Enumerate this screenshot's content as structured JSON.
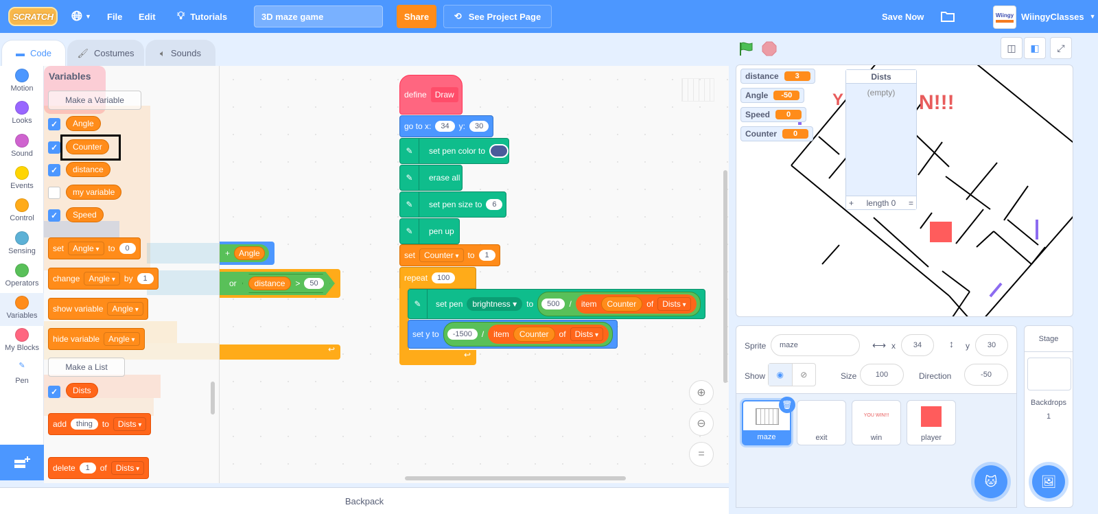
{
  "menubar": {
    "logo": "SCRATCH",
    "file": "File",
    "edit": "Edit",
    "tutorials": "Tutorials",
    "project_title": "3D maze game",
    "share": "Share",
    "see_project_page": "See Project Page",
    "save_now": "Save Now",
    "username": "WiingyClasses",
    "avatar_text": "Wiingy"
  },
  "tabs": [
    {
      "label": "Code",
      "active": true
    },
    {
      "label": "Costumes",
      "active": false
    },
    {
      "label": "Sounds",
      "active": false
    }
  ],
  "categories": [
    {
      "label": "Motion",
      "color": "#4c97ff"
    },
    {
      "label": "Looks",
      "color": "#9966ff"
    },
    {
      "label": "Sound",
      "color": "#cf63cf"
    },
    {
      "label": "Events",
      "color": "#ffd500"
    },
    {
      "label": "Control",
      "color": "#ffab19"
    },
    {
      "label": "Sensing",
      "color": "#5cb1d6"
    },
    {
      "label": "Operators",
      "color": "#59c059"
    },
    {
      "label": "Variables",
      "color": "#ff8c1a"
    },
    {
      "label": "My Blocks",
      "color": "#ff6680"
    },
    {
      "label": "Pen",
      "color": "#0fbd8c"
    }
  ],
  "palette": {
    "heading": "Variables",
    "make_variable": "Make a Variable",
    "variables": [
      {
        "name": "Angle",
        "checked": true
      },
      {
        "name": "Counter",
        "checked": true,
        "highlighted": true
      },
      {
        "name": "distance",
        "checked": true
      },
      {
        "name": "my variable",
        "checked": false
      },
      {
        "name": "Speed",
        "checked": true
      }
    ],
    "set_block": {
      "set": "set",
      "var": "Angle",
      "to": "to",
      "value": "0"
    },
    "change_block": {
      "change": "change",
      "var": "Angle",
      "by": "by",
      "value": "1"
    },
    "show_block": {
      "label": "show variable",
      "var": "Angle"
    },
    "hide_block": {
      "label": "hide variable",
      "var": "Angle"
    },
    "make_list": "Make a List",
    "list": {
      "name": "Dists",
      "checked": true
    },
    "add_block": {
      "add": "add",
      "value": "thing",
      "to": "to",
      "list": "Dists"
    },
    "delete_block": {
      "delete": "delete",
      "value": "1",
      "of": "of",
      "list": "Dists"
    }
  },
  "workspace": {
    "bg_blocks": {
      "plus": "+",
      "angle": "Angle",
      "or": "or",
      "distance": "distance",
      "gt": ">",
      "fifty": "50"
    },
    "script": {
      "define": "define",
      "define_name": "Draw",
      "goto": {
        "label": "go to x:",
        "x": "34",
        "ylabel": "y:",
        "y": "30"
      },
      "set_pen_color": {
        "label": "set pen color to",
        "color": "#4a5b9a"
      },
      "erase_all": "erase all",
      "set_pen_size": {
        "label": "set pen size to",
        "value": "6"
      },
      "pen_up": "pen up",
      "set_counter": {
        "set": "set",
        "var": "Counter",
        "to": "to",
        "value": "1"
      },
      "repeat": {
        "label": "repeat",
        "value": "100"
      },
      "set_pen_param": {
        "label": "set pen",
        "param": "brightness",
        "to": "to",
        "num": "500",
        "div": "/",
        "item": "item",
        "index": "Counter",
        "of": "of",
        "list": "Dists"
      },
      "set_y": {
        "label": "set y to",
        "num": "-1500",
        "div": "/",
        "item": "item",
        "index": "Counter",
        "of": "of",
        "list": "Dists"
      }
    },
    "zoom_reset": "="
  },
  "backpack": "Backpack",
  "stage": {
    "monitors": [
      {
        "name": "distance",
        "value": "3"
      },
      {
        "name": "Angle",
        "value": "-50"
      },
      {
        "name": "Speed",
        "value": "0"
      },
      {
        "name": "Counter",
        "value": "0"
      }
    ],
    "list_monitor": {
      "title": "Dists",
      "empty": "(empty)",
      "add": "+",
      "length": "length 0",
      "resize": "="
    },
    "win_text": "N!!!"
  },
  "sprite_info": {
    "sprite_label": "Sprite",
    "sprite_name": "maze",
    "x_label": "x",
    "x": "34",
    "y_label": "y",
    "y": "30",
    "show_label": "Show",
    "size_label": "Size",
    "size": "100",
    "direction_label": "Direction",
    "direction": "-50"
  },
  "sprites": [
    {
      "name": "maze",
      "selected": true
    },
    {
      "name": "exit",
      "selected": false
    },
    {
      "name": "win",
      "selected": false,
      "thumb_text": "YOU WIN!!!"
    },
    {
      "name": "player",
      "selected": false
    }
  ],
  "stage_pane": {
    "title": "Stage",
    "backdrops_label": "Backdrops",
    "backdrops_count": "1"
  }
}
